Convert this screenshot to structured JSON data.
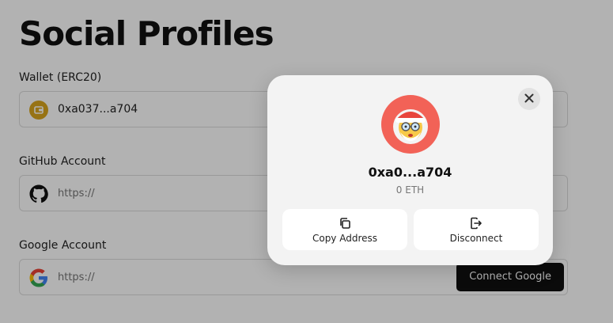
{
  "page": {
    "title": "Social Profiles"
  },
  "wallet": {
    "label": "Wallet (ERC20)",
    "value": "0xa037...a704",
    "icon": "wallet-icon",
    "icon_color": "#d9a51e"
  },
  "github": {
    "label": "GitHub Account",
    "placeholder": "https://",
    "icon": "github-icon"
  },
  "google": {
    "label": "Google Account",
    "placeholder": "https://",
    "button": "Connect Google",
    "icon": "google-icon"
  },
  "modal": {
    "address": "0xa0...a704",
    "balance": "0 ETH",
    "avatar_bg": "#f26257",
    "actions": [
      {
        "label": "Copy Address",
        "icon": "copy-icon"
      },
      {
        "label": "Disconnect",
        "icon": "logout-icon"
      }
    ],
    "close_icon": "close-icon"
  }
}
